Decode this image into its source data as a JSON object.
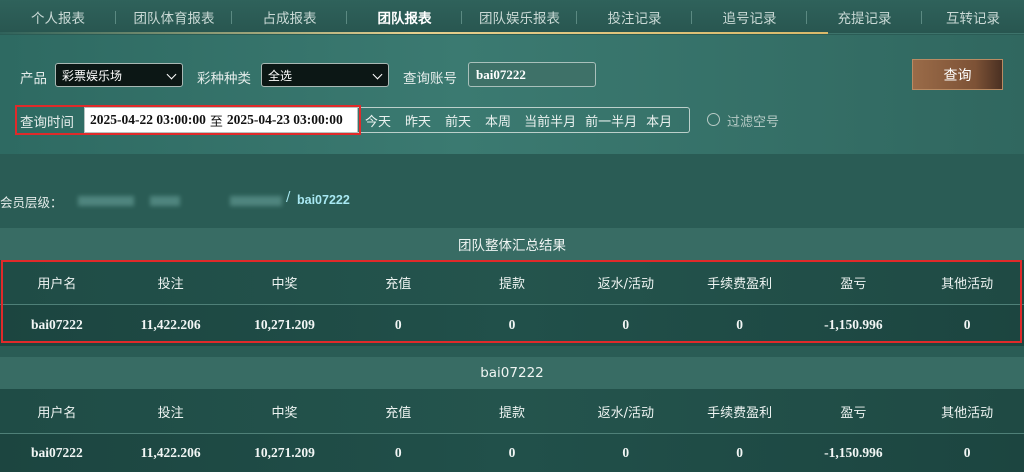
{
  "tabs": [
    {
      "label": "个人报表",
      "active": false
    },
    {
      "label": "团队体育报表",
      "active": false
    },
    {
      "label": "占成报表",
      "active": false
    },
    {
      "label": "团队报表",
      "active": true
    },
    {
      "label": "团队娱乐报表",
      "active": false
    },
    {
      "label": "投注记录",
      "active": false
    },
    {
      "label": "追号记录",
      "active": false
    },
    {
      "label": "充提记录",
      "active": false
    },
    {
      "label": "互转记录",
      "active": false
    }
  ],
  "filters": {
    "product_label": "产品",
    "product_value": "彩票娱乐场",
    "lottery_type_label": "彩种种类",
    "lottery_type_value": "全选",
    "account_label": "查询账号",
    "account_value": "bai07222",
    "query_button": "查询",
    "time_label": "查询时间",
    "date_start": "2025-04-22 03:00:00",
    "date_sep": "至",
    "date_end": "2025-04-23 03:00:00",
    "quick_ranges": [
      "今天",
      "昨天",
      "前天",
      "本周",
      "当前半月",
      "前一半月",
      "本月"
    ],
    "filter_empty_label": "过滤空号"
  },
  "member": {
    "label": "会员层级：",
    "separator": "/",
    "current_user": "bai07222"
  },
  "summary": {
    "title": "团队整体汇总结果",
    "headers": [
      "用户名",
      "投注",
      "中奖",
      "充值",
      "提款",
      "返水/活动",
      "手续费盈利",
      "盈亏",
      "其他活动"
    ],
    "rows": [
      [
        "bai07222",
        "11,422.206",
        "10,271.209",
        "0",
        "0",
        "0",
        "0",
        "-1,150.996",
        "0"
      ]
    ]
  },
  "detail": {
    "title": "bai07222",
    "headers": [
      "用户名",
      "投注",
      "中奖",
      "充值",
      "提款",
      "返水/活动",
      "手续费盈利",
      "盈亏",
      "其他活动"
    ],
    "rows": [
      [
        "bai07222",
        "11,422.206",
        "10,271.209",
        "0",
        "0",
        "0",
        "0",
        "-1,150.996",
        "0"
      ]
    ]
  },
  "colors": {
    "background": "#2a5c55",
    "highlight": "#e02a2a",
    "accent_gold": "#e5cf8e",
    "button": "#8a5c3e"
  }
}
